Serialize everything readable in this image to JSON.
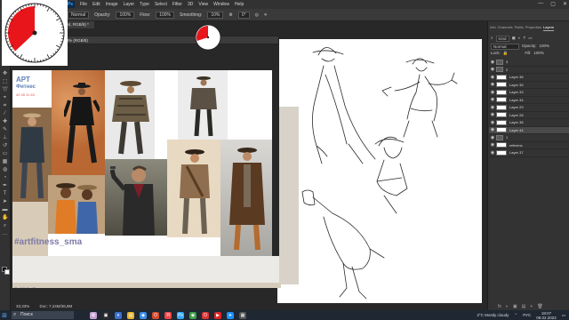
{
  "app": {
    "ps_badge": "Ps",
    "menu": [
      "File",
      "Edit",
      "Image",
      "Layer",
      "Type",
      "Select",
      "Filter",
      "3D",
      "View",
      "Window",
      "Help"
    ],
    "window_controls": [
      "—",
      "▢",
      "✕"
    ]
  },
  "options_bar": {
    "mode": "Normal",
    "opacity_label": "Opacity:",
    "opacity_value": "100%",
    "flow_label": "Flow:",
    "flow_value": "100%",
    "smoothing_label": "Smoothing:",
    "smoothing_value": "10%",
    "angle_value": "0°"
  },
  "document": {
    "tab_title": "Untitled-1 @ 56,8% (Layer 44, RGB/8) *",
    "floating_title": "Ref_collage.psd @ 56,8% (RGB/8)",
    "floating_zoom": "56,83%",
    "floating_doc": "Doc: 7,24M/36,8M",
    "status_zoom": "33,33%",
    "status_doc": "Doc: 7,24M/36,8M"
  },
  "collage": {
    "brand_line1": "АРТ",
    "brand_line2": "Фитнес",
    "brand_sub": "42 45 11 63",
    "hashtag": "#artfitness_sma",
    "behind_text": "sma",
    "colors": {
      "brand_blue": "#5f7fb6",
      "hashtag_color": "#7e7aa8"
    }
  },
  "right_panel": {
    "tabs": [
      "Info",
      "Channels",
      "Paths",
      "Properties",
      "Layers"
    ],
    "active_tab": "Layers",
    "kind_label": "Kind",
    "blend_mode": "Normal",
    "opacity_label": "Opacity:",
    "opacity_value": "100%",
    "lock_label": "Lock:",
    "fill_label": "Fill:",
    "fill_value": "100%",
    "layers": [
      {
        "name": "3",
        "group": true,
        "selected": false
      },
      {
        "name": "2",
        "group": true,
        "selected": false
      },
      {
        "name": "Layer 36",
        "group": false,
        "selected": false
      },
      {
        "name": "Layer 35",
        "group": false,
        "selected": false
      },
      {
        "name": "Layer 33",
        "group": false,
        "selected": false
      },
      {
        "name": "Layer 34",
        "group": false,
        "selected": false
      },
      {
        "name": "Layer 29",
        "group": false,
        "selected": false
      },
      {
        "name": "Layer 28",
        "group": false,
        "selected": false
      },
      {
        "name": "Layer 38",
        "group": false,
        "selected": false
      },
      {
        "name": "Layer 44",
        "group": false,
        "selected": true
      },
      {
        "name": "1",
        "group": true,
        "selected": false
      },
      {
        "name": "referenc",
        "group": false,
        "selected": false
      },
      {
        "name": "Layer 37",
        "group": false,
        "selected": false
      }
    ],
    "bottom_icons": [
      "fx",
      "◐",
      "▣",
      "▤",
      "+",
      "🗑"
    ]
  },
  "taskbar": {
    "search_placeholder": "Поиск",
    "weather": "3°C  Mostly cloudy",
    "lang": "РУС",
    "time": "18:07",
    "date": "08.02.2022"
  },
  "timers": {
    "big_remaining_fraction": 0.37,
    "small_remaining_fraction": 0.3,
    "color": "#e8161b"
  }
}
